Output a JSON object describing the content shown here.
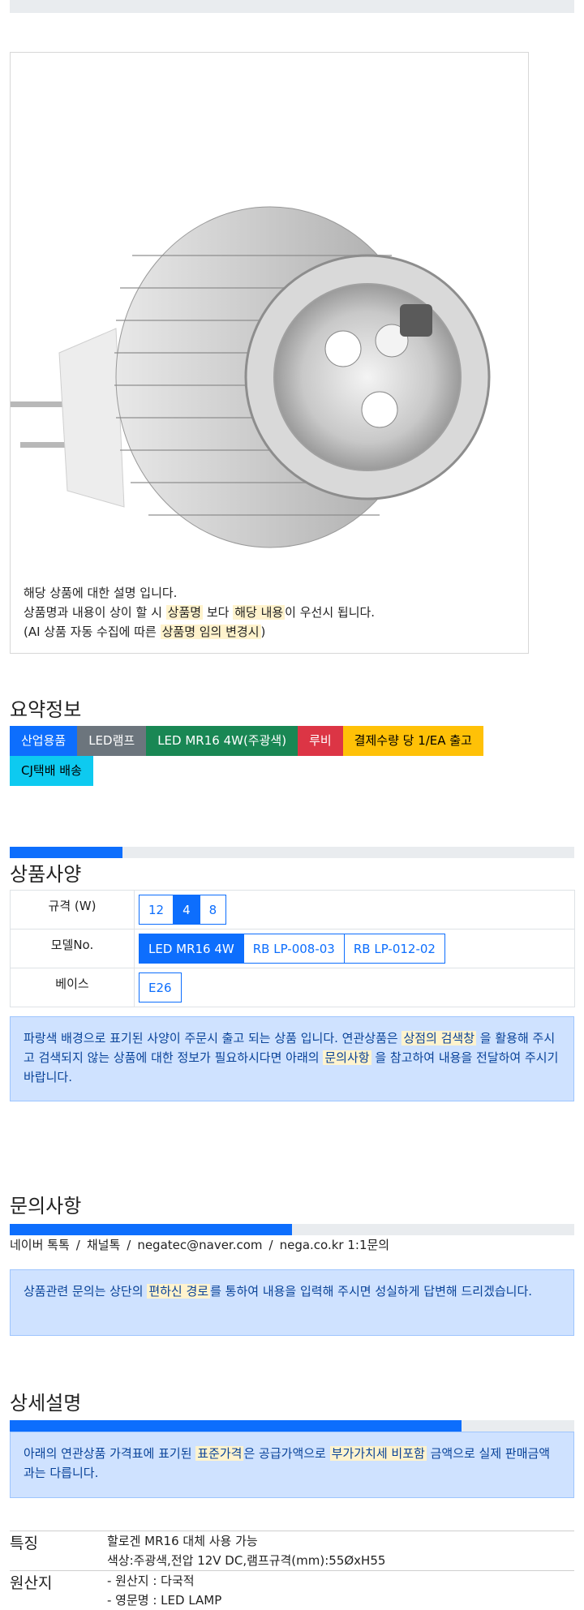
{
  "product": {
    "image_alt": "LED MR16 lamp",
    "desc_line1": "해당 상품에 대한 설명 입니다.",
    "desc_line2_a": "상품명과 내용이 상이 할 시 ",
    "desc_line2_hl1": "상품명",
    "desc_line2_b": " 보다 ",
    "desc_line2_hl2": "해당 내용",
    "desc_line2_c": "이 우선시 됩니다.",
    "desc_line3_a": "(AI 상품 자동 수집에 따른 ",
    "desc_line3_hl": "상품명 임의 변경시",
    "desc_line3_b": ")"
  },
  "summary": {
    "title": "요약정보",
    "badges": [
      {
        "label": "산업용품",
        "color": "#0d6efd",
        "text": "#ffffff"
      },
      {
        "label": "LED램프",
        "color": "#6c757d",
        "text": "#ffffff"
      },
      {
        "label": "LED MR16 4W(주광색)",
        "color": "#198754",
        "text": "#ffffff"
      },
      {
        "label": "루비",
        "color": "#dc3545",
        "text": "#ffffff"
      },
      {
        "label": "결제수량 당 1/EA 출고",
        "color": "#ffc107",
        "text": "#000000"
      },
      {
        "label": "CJ택배 배송",
        "color": "#0dcaf0",
        "text": "#000000"
      }
    ]
  },
  "spec": {
    "progress_fraction": 0.2,
    "title": "상품사양",
    "rows": [
      {
        "key": "규격 (W)",
        "options": [
          "12",
          "4",
          "8"
        ],
        "selected": 1
      },
      {
        "key": "모델No.",
        "options": [
          "LED MR16 4W",
          "RB LP-008-03",
          "RB LP-012-02"
        ],
        "selected": 0
      },
      {
        "key": "베이스",
        "options": [
          "E26"
        ],
        "selected": -1
      }
    ],
    "note_a": "파랑색 배경으로 표기된 사양이 주문시 출고 되는 상품 입니다. 연관상품은 ",
    "note_hl1": "상점의 검색창",
    "note_b": " 을 활용해 주시고 검색되지 않는 상품에 대한 정보가 필요하시다면 아래의 ",
    "note_hl2": "문의사항",
    "note_c": " 을 참고하여 내용을 전달하여 주시기 바랍니다."
  },
  "inquiry": {
    "title": "문의사항",
    "progress_fraction": 0.5,
    "contacts": [
      "네이버 톡톡",
      "채널톡",
      "negatec@naver.com",
      "nega.co.kr 1:1문의"
    ],
    "separator": "/",
    "note_a": "상품관련 문의는 상단의 ",
    "note_hl": "편하신 경로",
    "note_b": "를 통하여 내용을 입력해 주시면 성실하게 답변해 드리겠습니다."
  },
  "detail": {
    "title": "상세설명",
    "progress_fraction": 0.8,
    "note_a": "아래의 연관상품 가격표에 표기된 ",
    "note_hl1": "표준가격",
    "note_b": "은 공급가액으로 ",
    "note_hl2": "부가가치세 비포함",
    "note_c": " 금액으로 실제 판매금액과는 다릅니다.",
    "feature_key": "특징",
    "feature_lines": [
      "할로겐 MR16 대체 사용 가능",
      "색상:주광색,전압 12V DC,램프규격(mm):55ØxH55"
    ],
    "origin_key": "원산지",
    "origin_lines": [
      "- 원산지 : 다국적",
      "- 영문명 : LED LAMP"
    ]
  }
}
